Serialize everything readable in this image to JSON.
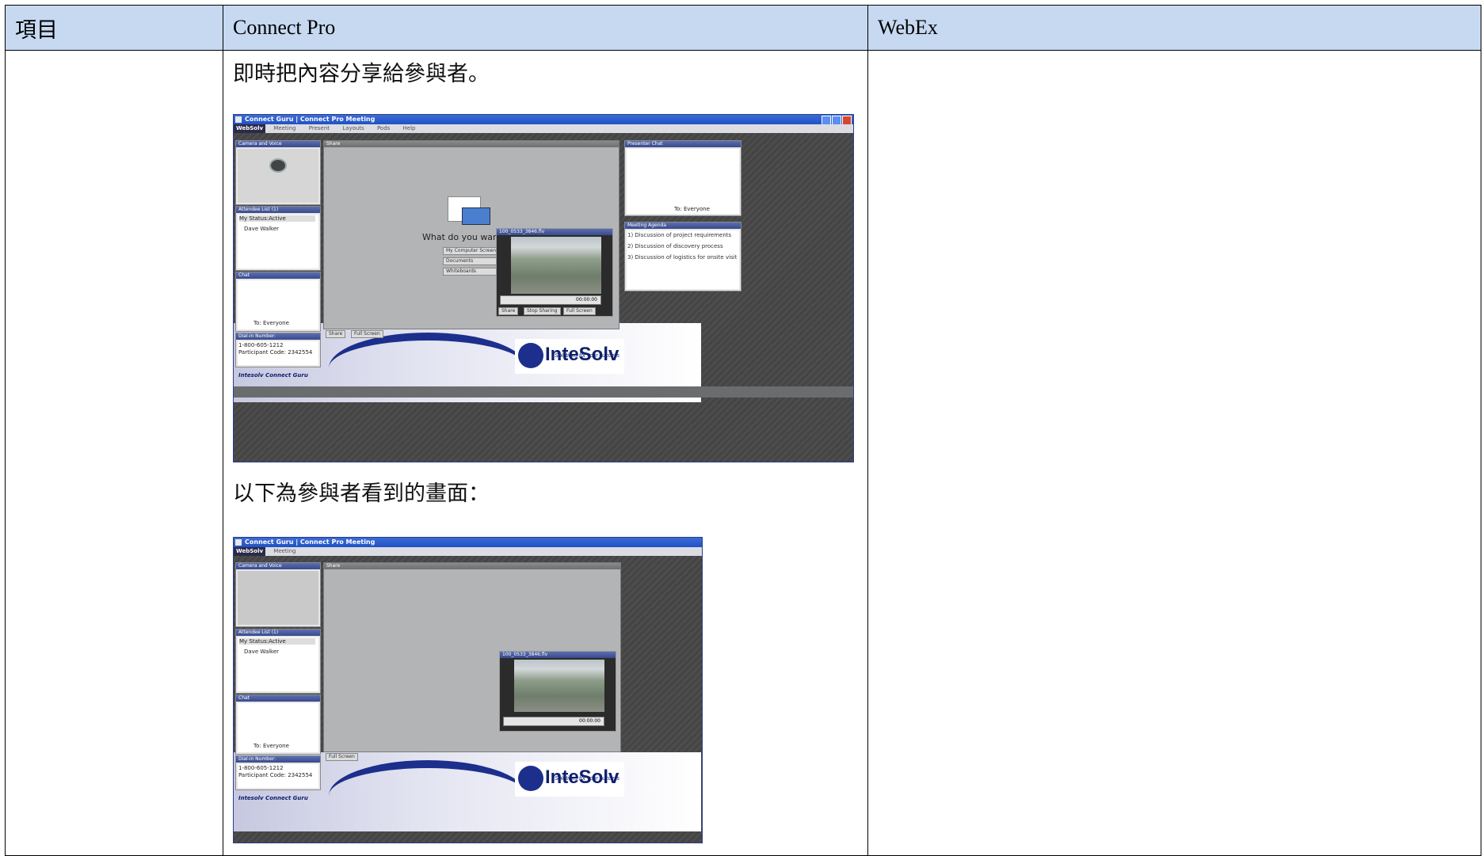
{
  "table": {
    "header": [
      "項目",
      "Connect Pro",
      "WebEx"
    ],
    "row": {
      "item": "",
      "connect_pro": {
        "caption_1": "即時把內容分享給參與者。",
        "caption_2": "以下為參與者看到的畫面：",
        "presenter_screenshot": {
          "window_title": "Connect Guru | Connect Pro Meeting",
          "menu": [
            "WebSolv",
            "Meeting",
            "Present",
            "Layouts",
            "Pods",
            "Help"
          ],
          "pods": {
            "camera": "Camera and Voice",
            "attendees": "Attendee List (1)",
            "status": "My Status:Active",
            "attendee_name": "Dave Walker",
            "chat": "Chat",
            "chat_to": "To: Everyone",
            "dialin": "Dial-in Number:",
            "dialin_number": "1-800-605-1212",
            "participant_code": "Participant Code: 2342554",
            "share": "Share",
            "share_prompt": "What do you want to",
            "share_options": [
              "My Computer Screen...",
              "Documents",
              "Whiteboards"
            ],
            "video_title": "100_0533_3846.flv",
            "video_time": "00:00:00",
            "video_buttons": [
              "Share",
              "Stop Sharing",
              "Full Screen"
            ],
            "share_footer": [
              "Share",
              "Full Screen"
            ],
            "presenter_chat": "Presenter Chat",
            "presenter_chat_to": "To: Everyone",
            "agenda_title": "Meeting Agenda",
            "agenda": [
              "1) Discussion of project requirements",
              "2) Discussion of discovery process",
              "3) Discussion of logistics for onsite visit"
            ],
            "brand_footer": "Intesolv Connect Guru",
            "logo_text": "InteSolv",
            "logo_tag": "Solutions for your success"
          }
        },
        "participant_screenshot": {
          "window_title": "Connect Guru | Connect Pro Meeting",
          "menu": [
            "WebSolv",
            "Meeting"
          ],
          "pods": {
            "camera": "Camera and Voice",
            "attendees": "Attendee List (1)",
            "status": "My Status:Active",
            "attendee_name": "Dave Walker",
            "chat": "Chat",
            "chat_to": "To: Everyone",
            "dialin": "Dial-in Number:",
            "dialin_number": "1-800-605-1212",
            "participant_code": "Participant Code: 2342554",
            "share": "Share",
            "video_title": "100_0533_3846.flv",
            "video_time": "00:00:00",
            "share_footer": [
              "Full Screen"
            ],
            "brand_footer": "Intesolv Connect Guru",
            "logo_text": "InteSolv",
            "logo_tag": "Solutions for your success"
          }
        }
      },
      "webex": ""
    }
  },
  "colors": {
    "header_bg": "#c6d9f1",
    "accent": "#1c2f8c"
  }
}
